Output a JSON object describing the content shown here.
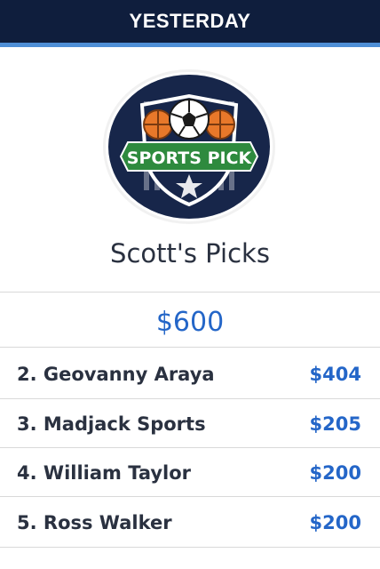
{
  "header": {
    "title": "YESTERDAY"
  },
  "logo": {
    "text": "SPORTS PICK",
    "icon": "sports-pick-logo"
  },
  "page": {
    "title": "Scott's Picks",
    "total": "$600"
  },
  "rows": [
    {
      "name": "2. Geovanny Araya",
      "amount": "$404"
    },
    {
      "name": "3. Madjack Sports",
      "amount": "$205"
    },
    {
      "name": "4. William Taylor",
      "amount": "$200"
    },
    {
      "name": "5. Ross Walker",
      "amount": "$200"
    }
  ],
  "colors": {
    "header_bg": "#0f1e3d",
    "accent": "#4f8fd6",
    "amount": "#2466c8",
    "text": "#2a3140"
  }
}
